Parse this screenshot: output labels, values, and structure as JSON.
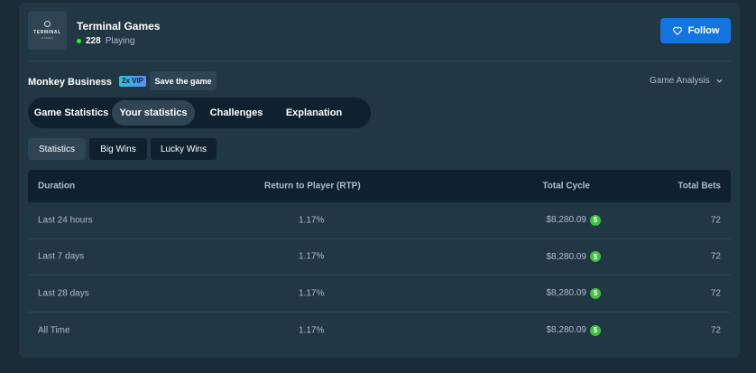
{
  "provider": {
    "logo_text": "TERMINAL",
    "logo_subtext": "GAMES",
    "name": "Terminal Games",
    "players_count": "228",
    "players_label": "Playing"
  },
  "follow_button": {
    "label": "Follow",
    "icon": "heart-icon"
  },
  "game": {
    "title": "Monkey Business",
    "vip_badge": "2x VIP",
    "save_label": "Save the game",
    "analysis_label": "Game Analysis"
  },
  "main_tabs": [
    {
      "label": "Game Statistics",
      "active": false
    },
    {
      "label": "Your statistics",
      "active": true
    },
    {
      "label": "Challenges",
      "active": false
    },
    {
      "label": "Explanation",
      "active": false
    }
  ],
  "sub_tabs": [
    {
      "label": "Statistics",
      "active": true
    },
    {
      "label": "Big Wins",
      "active": false
    },
    {
      "label": "Lucky Wins",
      "active": false
    }
  ],
  "table": {
    "headers": [
      "Duration",
      "Return to Player (RTP)",
      "Total Cycle",
      "Total Bets"
    ],
    "currency_icon_glyph": "$",
    "rows": [
      {
        "duration": "Last 24 hours",
        "rtp": "1.17%",
        "total_cycle": "$8,280.09",
        "total_bets": "72"
      },
      {
        "duration": "Last 7 days",
        "rtp": "1.17%",
        "total_cycle": "$8,280.09",
        "total_bets": "72"
      },
      {
        "duration": "Last 28 days",
        "rtp": "1.17%",
        "total_cycle": "$8,280.09",
        "total_bets": "72"
      },
      {
        "duration": "All Time",
        "rtp": "1.17%",
        "total_cycle": "$8,280.09",
        "total_bets": "72"
      }
    ]
  },
  "colors": {
    "background": "#1a2c38",
    "panel": "#213743",
    "accent_blue": "#1475e1",
    "online_green": "#1fff20",
    "coin_green": "#3ec13e"
  }
}
